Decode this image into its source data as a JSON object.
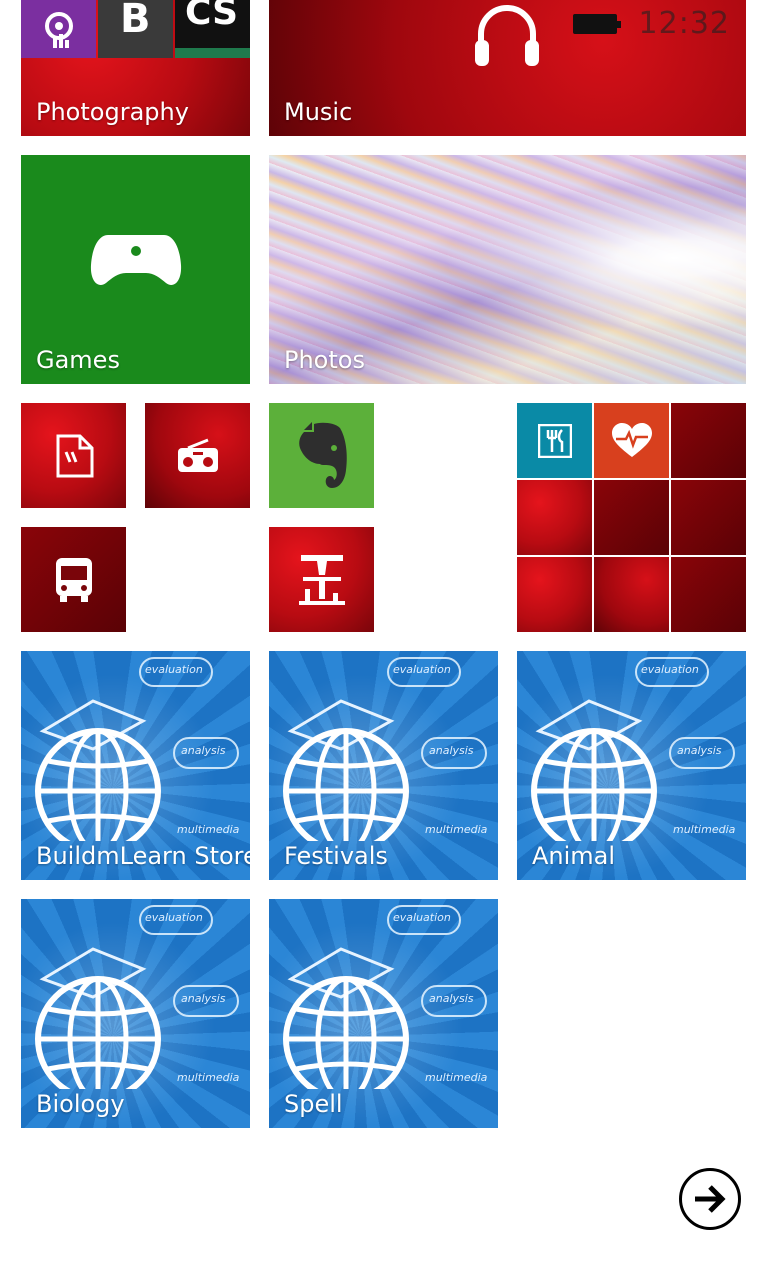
{
  "status_bar": {
    "time": "12:32"
  },
  "tiles": {
    "photography": {
      "label": "Photography",
      "mini": {
        "b_letter": "B",
        "cs_text": "CS"
      }
    },
    "music": {
      "label": "Music"
    },
    "games": {
      "label": "Games"
    },
    "photos": {
      "label": "Photos"
    },
    "buildmlearn": {
      "label": "BuildmLearn Store"
    },
    "festivals": {
      "label": "Festivals"
    },
    "animal": {
      "label": "Animal"
    },
    "biology": {
      "label": "Biology"
    },
    "spell": {
      "label": "Spell"
    }
  },
  "learn_tile_words": {
    "w1": "evaluation",
    "w2": "analysis",
    "w3": "multimedia"
  },
  "colors": {
    "games_green": "#1a8a1c",
    "evernote_green": "#5cb03a",
    "food_teal": "#0a8aa6",
    "health_orange": "#d8401e",
    "photography_purple": "#7b2fa0"
  }
}
